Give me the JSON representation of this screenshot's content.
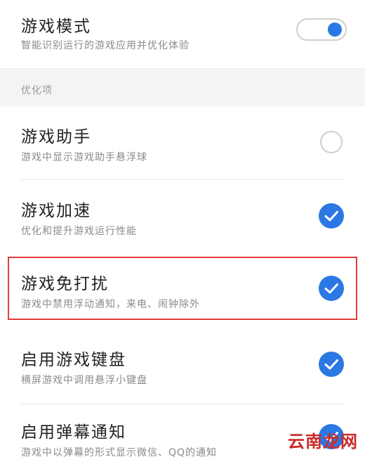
{
  "game_mode": {
    "title": "游戏模式",
    "desc": "智能识别运行的游戏应用并优化体验",
    "enabled": true
  },
  "section": {
    "label": "优化项"
  },
  "items": [
    {
      "title": "游戏助手",
      "desc": "游戏中显示游戏助手悬浮球",
      "checked": false
    },
    {
      "title": "游戏加速",
      "desc": "优化和提升游戏运行性能",
      "checked": true
    },
    {
      "title": "游戏免打扰",
      "desc": "游戏中禁用浮动通知，来电、闹钟除外",
      "checked": true
    },
    {
      "title": "启用游戏键盘",
      "desc": "横屏游戏中调用悬浮小键盘",
      "checked": true
    },
    {
      "title": "启用弹幕通知",
      "desc": "游戏中以弹幕的形式显示微信、QQ的通知",
      "checked": true
    }
  ],
  "watermark": "云南龙网",
  "colors": {
    "accent": "#2b78e4",
    "highlight_border": "#e23d3d"
  }
}
